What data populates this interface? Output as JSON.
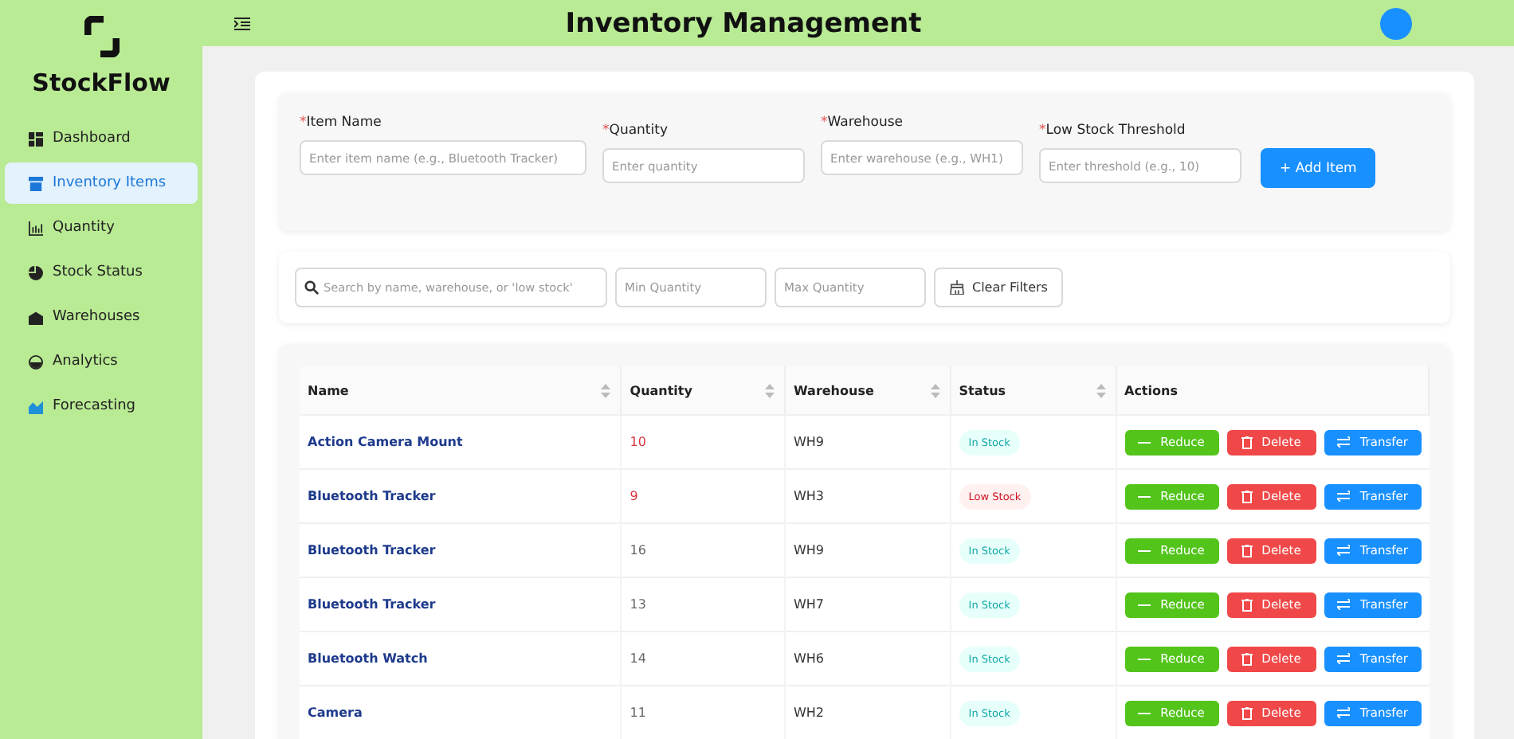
{
  "sidebar": {
    "brand": "StockFlow",
    "items": [
      {
        "label": "Dashboard",
        "selected": false
      },
      {
        "label": "Inventory Items",
        "selected": true
      },
      {
        "label": "Quantity",
        "selected": false
      },
      {
        "label": "Stock Status",
        "selected": false
      },
      {
        "label": "Warehouses",
        "selected": false
      },
      {
        "label": "Analytics",
        "selected": false
      },
      {
        "label": "Forecasting",
        "selected": false
      }
    ]
  },
  "header": {
    "title": "Inventory Management"
  },
  "form": {
    "fields": [
      {
        "mark": "*",
        "label": "Item Name",
        "placeholder": "Enter item name (e.g., Bluetooth Tracker)"
      },
      {
        "mark": "*",
        "label": "Quantity",
        "placeholder": "Enter quantity"
      },
      {
        "mark": "*",
        "label": "Warehouse",
        "placeholder": "Enter warehouse (e.g., WH1)"
      },
      {
        "mark": "*",
        "label": "Low Stock Threshold",
        "placeholder": "Enter threshold (e.g., 10)"
      }
    ],
    "submit": "+ Add Item"
  },
  "filters": {
    "search_placeholder": "Search by name, warehouse, or 'low stock'",
    "min_placeholder": "Min Quantity",
    "max_placeholder": "Max Quantity",
    "clear": "Clear Filters"
  },
  "table": {
    "columns": [
      {
        "label": "Name",
        "sortable": true
      },
      {
        "label": "Quantity",
        "sortable": true
      },
      {
        "label": "Warehouse",
        "sortable": true
      },
      {
        "label": "Status",
        "sortable": true
      },
      {
        "label": "Actions",
        "sortable": false
      }
    ],
    "rows": [
      {
        "name": "Action Camera Mount",
        "quantity": "10",
        "quantity_low": true,
        "warehouse": "WH9",
        "status": "In Stock",
        "low_stock": false,
        "actions": [
          {
            "label": "Reduce",
            "kind": "reduce"
          },
          {
            "label": "Delete",
            "kind": "delete"
          },
          {
            "label": "Transfer",
            "kind": "transfer"
          }
        ]
      },
      {
        "name": "Bluetooth Tracker",
        "quantity": "9",
        "quantity_low": true,
        "warehouse": "WH3",
        "status": "Low Stock",
        "low_stock": true,
        "actions": [
          {
            "label": "Reduce",
            "kind": "reduce"
          },
          {
            "label": "Delete",
            "kind": "delete"
          },
          {
            "label": "Transfer",
            "kind": "transfer"
          }
        ]
      },
      {
        "name": "Bluetooth Tracker",
        "quantity": "16",
        "quantity_low": false,
        "warehouse": "WH9",
        "status": "In Stock",
        "low_stock": false,
        "actions": [
          {
            "label": "Reduce",
            "kind": "reduce"
          },
          {
            "label": "Delete",
            "kind": "delete"
          },
          {
            "label": "Transfer",
            "kind": "transfer"
          }
        ]
      },
      {
        "name": "Bluetooth Tracker",
        "quantity": "13",
        "quantity_low": false,
        "warehouse": "WH7",
        "status": "In Stock",
        "low_stock": false,
        "actions": [
          {
            "label": "Reduce",
            "kind": "reduce"
          },
          {
            "label": "Delete",
            "kind": "delete"
          },
          {
            "label": "Transfer",
            "kind": "transfer"
          }
        ]
      },
      {
        "name": "Bluetooth Watch",
        "quantity": "14",
        "quantity_low": false,
        "warehouse": "WH6",
        "status": "In Stock",
        "low_stock": false,
        "actions": [
          {
            "label": "Reduce",
            "kind": "reduce"
          },
          {
            "label": "Delete",
            "kind": "delete"
          },
          {
            "label": "Transfer",
            "kind": "transfer"
          }
        ]
      },
      {
        "name": "Camera",
        "quantity": "11",
        "quantity_low": false,
        "warehouse": "WH2",
        "status": "In Stock",
        "low_stock": false,
        "actions": [
          {
            "label": "Reduce",
            "kind": "reduce"
          },
          {
            "label": "Delete",
            "kind": "delete"
          },
          {
            "label": "Transfer",
            "kind": "transfer"
          }
        ]
      }
    ]
  }
}
